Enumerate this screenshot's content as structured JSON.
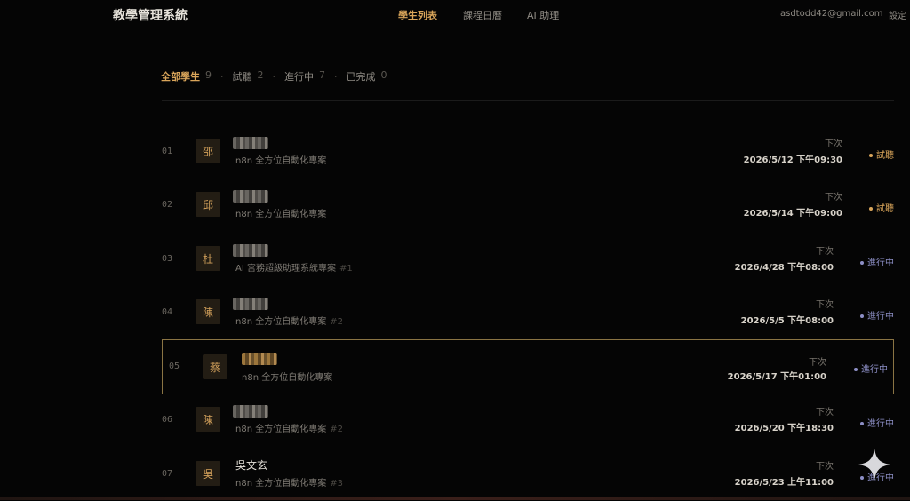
{
  "header": {
    "brand": "教學管理系統",
    "nav": [
      "學生列表",
      "課程日曆",
      "AI 助理"
    ],
    "email": "asdtodd42@gmail.com",
    "settings": "設定"
  },
  "filters": [
    {
      "label": "全部學生",
      "count": "9"
    },
    {
      "label": "試聽",
      "count": "2"
    },
    {
      "label": "進行中",
      "count": "7"
    },
    {
      "label": "已完成",
      "count": "0"
    }
  ],
  "next_label": "下次",
  "students": [
    {
      "index": "01",
      "avatar": "邵",
      "name": "",
      "course": "n8n 全方位自動化專案",
      "tag": "",
      "next_time": "2026/5/12 下午09:30",
      "status": "試聽"
    },
    {
      "index": "02",
      "avatar": "邱",
      "name": "",
      "course": "n8n 全方位自動化專案",
      "tag": "",
      "next_time": "2026/5/14 下午09:00",
      "status": "試聽"
    },
    {
      "index": "03",
      "avatar": "杜",
      "name": "",
      "course": "AI 宮務超級助理系統專案",
      "tag": "#1",
      "next_time": "2026/4/28 下午08:00",
      "status": "進行中"
    },
    {
      "index": "04",
      "avatar": "陳",
      "name": "",
      "course": "n8n 全方位自動化專案",
      "tag": "#2",
      "next_time": "2026/5/5 下午08:00",
      "status": "進行中"
    },
    {
      "index": "05",
      "avatar": "蔡",
      "name": "",
      "course": "n8n 全方位自動化專案",
      "tag": "",
      "next_time": "2026/5/17 下午01:00",
      "status": "進行中"
    },
    {
      "index": "06",
      "avatar": "陳",
      "name": "",
      "course": "n8n 全方位自動化專案",
      "tag": "#2",
      "next_time": "2026/5/20 下午18:30",
      "status": "進行中"
    },
    {
      "index": "07",
      "avatar": "吳",
      "name": "吳文玄",
      "course": "n8n 全方位自動化專案",
      "tag": "#3",
      "next_time": "2026/5/23 上午11:00",
      "status": "進行中"
    }
  ],
  "colors": {
    "accent": "#d9a55a",
    "in_progress": "#8d8fc6",
    "background": "#050505"
  }
}
